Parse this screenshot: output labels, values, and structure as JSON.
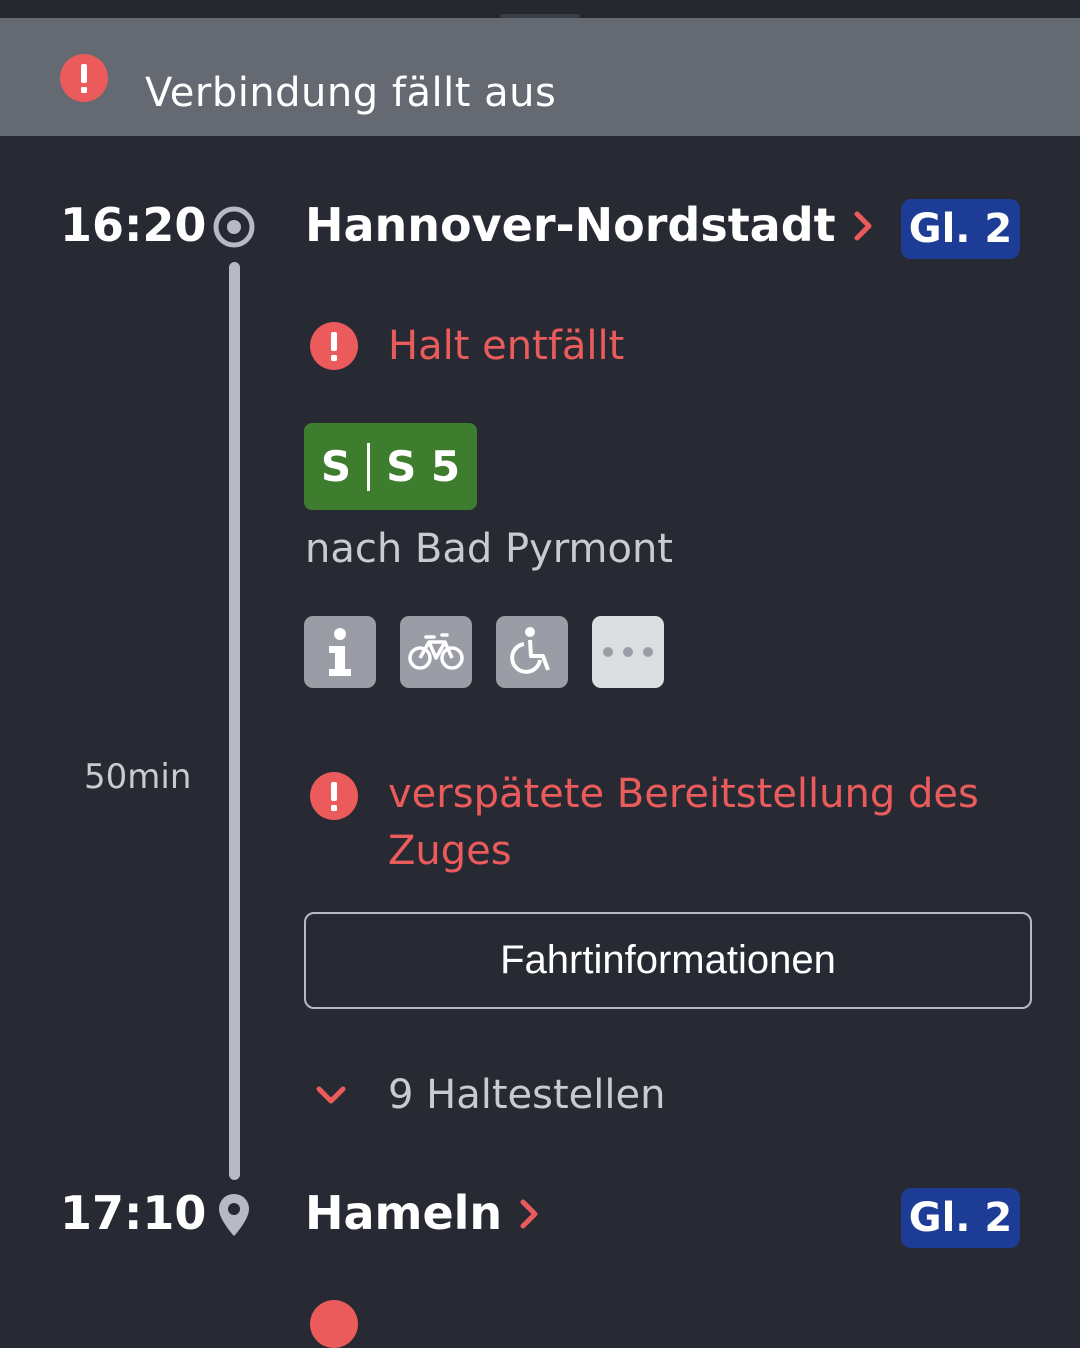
{
  "banner": {
    "icon": "alert-icon",
    "text": "Verbindung fällt aus"
  },
  "origin": {
    "time": "16:20",
    "station": "Hannover-Nordstadt",
    "platform": "Gl. 2",
    "icon": "origin-circle-icon"
  },
  "alerts": {
    "stop": "Halt entfällt",
    "delay_line1": "verspätete Bereitstellung des",
    "delay_line2": "Zuges"
  },
  "line": {
    "product": "S",
    "number": "S 5",
    "direction": "nach Bad Pyrmont",
    "badge_color": "#3f7d2e"
  },
  "attributes": [
    {
      "icon": "info-icon"
    },
    {
      "icon": "bicycle-icon"
    },
    {
      "icon": "wheelchair-icon"
    },
    {
      "icon": "more-icon"
    }
  ],
  "duration": "50min",
  "trip_info_button": "Fahrtinformationen",
  "stops_toggle": "9 Haltestellen",
  "destination": {
    "time": "17:10",
    "station": "Hameln",
    "platform": "Gl. 2",
    "icon": "location-pin-icon"
  },
  "colors": {
    "background": "#272a33",
    "banner": "#656972",
    "alert": "#ec5b5b",
    "platform_badge": "#1d3c96",
    "text_secondary": "#c8cbd2"
  }
}
